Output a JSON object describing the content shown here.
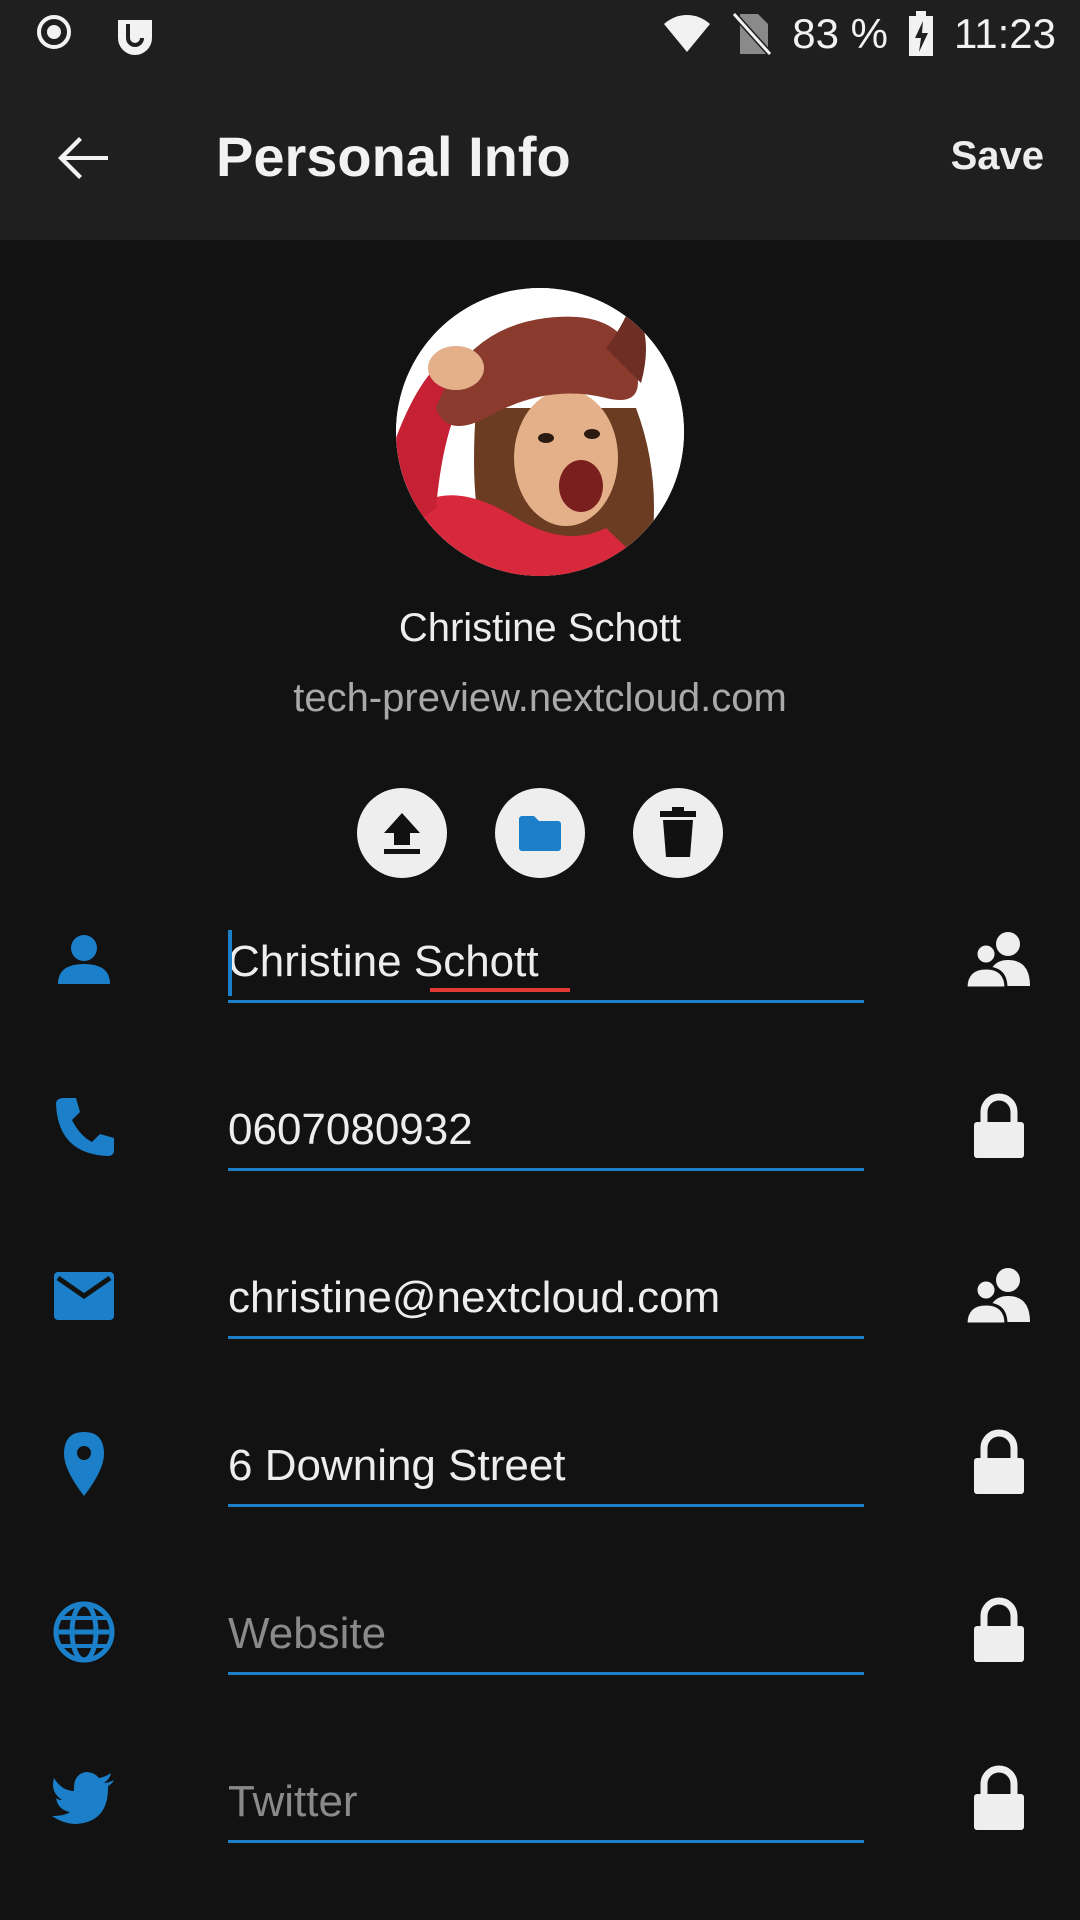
{
  "status_bar": {
    "battery_text": "83 %",
    "time": "11:23",
    "icons": [
      "record-icon",
      "nextcloud-notification-icon",
      "wifi-icon",
      "no-sim-icon",
      "battery-charging-icon"
    ]
  },
  "app_bar": {
    "title": "Personal Info",
    "save_label": "Save",
    "back_icon": "arrow-back-icon"
  },
  "profile": {
    "display_name": "Christine Schott",
    "server": "tech-preview.nextcloud.com"
  },
  "avatar_actions": [
    {
      "name": "upload-icon"
    },
    {
      "name": "folder-icon"
    },
    {
      "name": "delete-icon"
    }
  ],
  "fields": [
    {
      "name": "full-name",
      "icon": "person-icon",
      "value": "Christine Schott",
      "placeholder": "",
      "scope_icon": "contacts-scope-icon"
    },
    {
      "name": "phone",
      "icon": "phone-icon",
      "value": "0607080932",
      "placeholder": "",
      "scope_icon": "lock-icon"
    },
    {
      "name": "email",
      "icon": "email-icon",
      "value": "christine@nextcloud.com",
      "placeholder": "",
      "scope_icon": "contacts-scope-icon"
    },
    {
      "name": "address",
      "icon": "location-pin-icon",
      "value": "6 Downing Street",
      "placeholder": "",
      "scope_icon": "lock-icon"
    },
    {
      "name": "website",
      "icon": "globe-icon",
      "value": "",
      "placeholder": "Website",
      "scope_icon": "lock-icon"
    },
    {
      "name": "twitter",
      "icon": "twitter-icon",
      "value": "",
      "placeholder": "Twitter",
      "scope_icon": "lock-icon"
    }
  ],
  "colors": {
    "accent": "#1b7fc9",
    "background": "#121212",
    "toolbar": "#1f1f1f",
    "spellcheck": "#e53935"
  }
}
